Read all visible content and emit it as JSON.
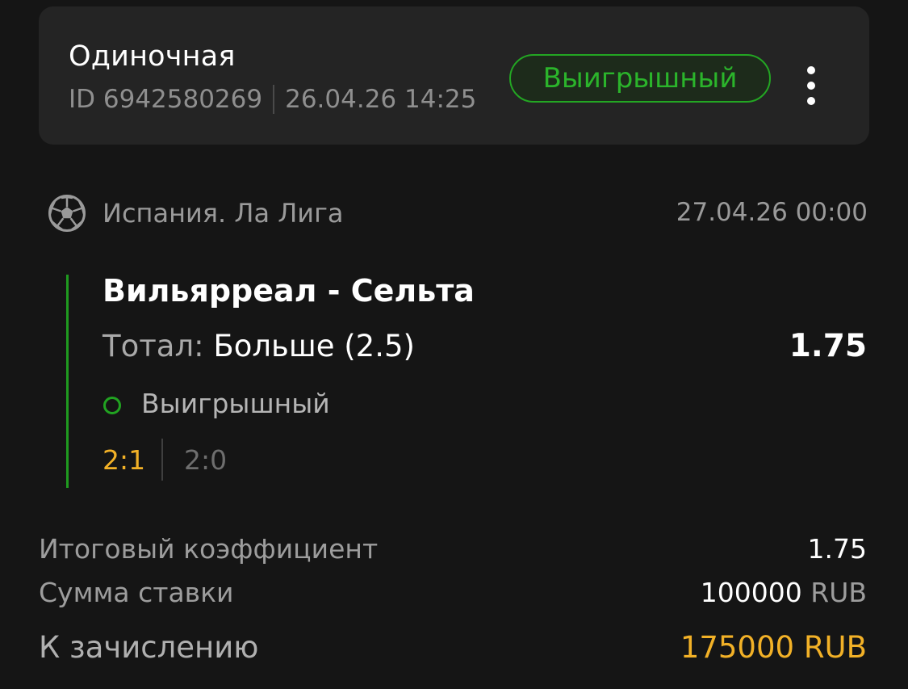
{
  "bet": {
    "type": "Одиночная",
    "id_prefix": "ID",
    "id": "6942580269",
    "placed_at": "26.04.26 14:25",
    "status": "Выигрышный"
  },
  "event": {
    "league": "Испания. Ла Лига",
    "league_icon": "soccer-ball-icon",
    "date": "27.04.26 00:00",
    "match": "Вильярреал - Сельта",
    "market_label": "Тотал:",
    "market_value": "Больше (2.5)",
    "odds": "1.75",
    "result": "Выигрышный",
    "score": "2:1",
    "half_score": "2:0"
  },
  "summary": {
    "total_odds_label": "Итоговый коэффициент",
    "total_odds": "1.75",
    "stake_label": "Сумма ставки",
    "stake_amount": "100000",
    "stake_currency": "RUB",
    "payout_label": "К зачислению",
    "payout": "175000 RUB"
  },
  "colors": {
    "background": "#151515",
    "card": "#242424",
    "win_green": "#23a623",
    "accent_yellow": "#f2b127"
  }
}
